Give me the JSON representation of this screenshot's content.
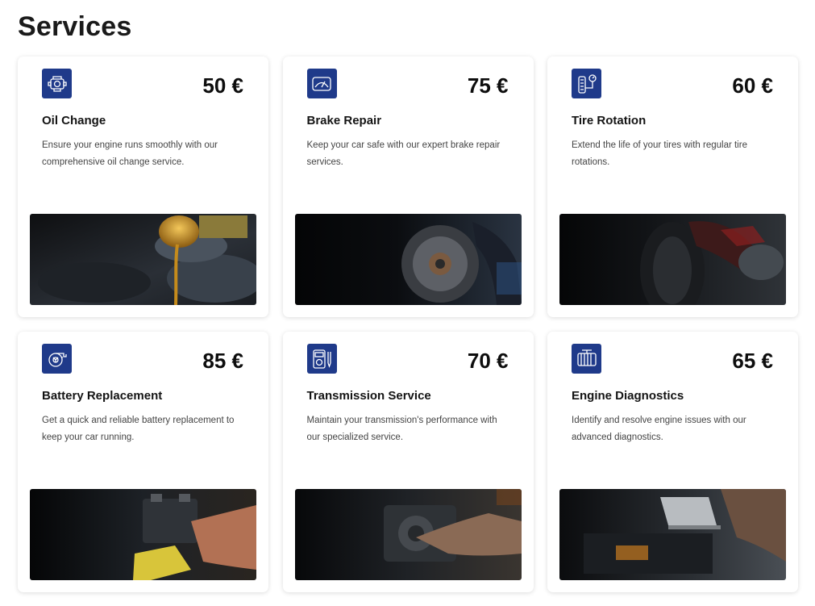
{
  "page": {
    "title": "Services"
  },
  "services": [
    {
      "title": "Oil Change",
      "price": "50 €",
      "description": "Ensure your engine runs smoothly with our comprehensive oil change service.",
      "icon": "engine-icon",
      "photo": "oil-pouring-photo"
    },
    {
      "title": "Brake Repair",
      "price": "75 €",
      "description": "Keep your car safe with our expert brake repair services.",
      "icon": "windshield-icon",
      "photo": "brake-disc-photo"
    },
    {
      "title": "Tire Rotation",
      "price": "60 €",
      "description": "Extend the life of your tires with regular tire rotations.",
      "icon": "tire-pressure-icon",
      "photo": "tire-photo"
    },
    {
      "title": "Battery Replacement",
      "price": "85 €",
      "description": "Get a quick and reliable battery replacement to keep your car running.",
      "icon": "turbo-icon",
      "photo": "battery-photo"
    },
    {
      "title": "Transmission Service",
      "price": "70 €",
      "description": "Maintain your transmission's performance with our specialized service.",
      "icon": "multimeter-icon",
      "photo": "transmission-photo"
    },
    {
      "title": "Engine Diagnostics",
      "price": "65 €",
      "description": "Identify and resolve engine issues with our advanced diagnostics.",
      "icon": "radiator-icon",
      "photo": "diagnostics-laptop-photo"
    }
  ],
  "colors": {
    "icon_bg": "#1f3a8a",
    "card_bg": "#ffffff",
    "text": "#141414"
  }
}
